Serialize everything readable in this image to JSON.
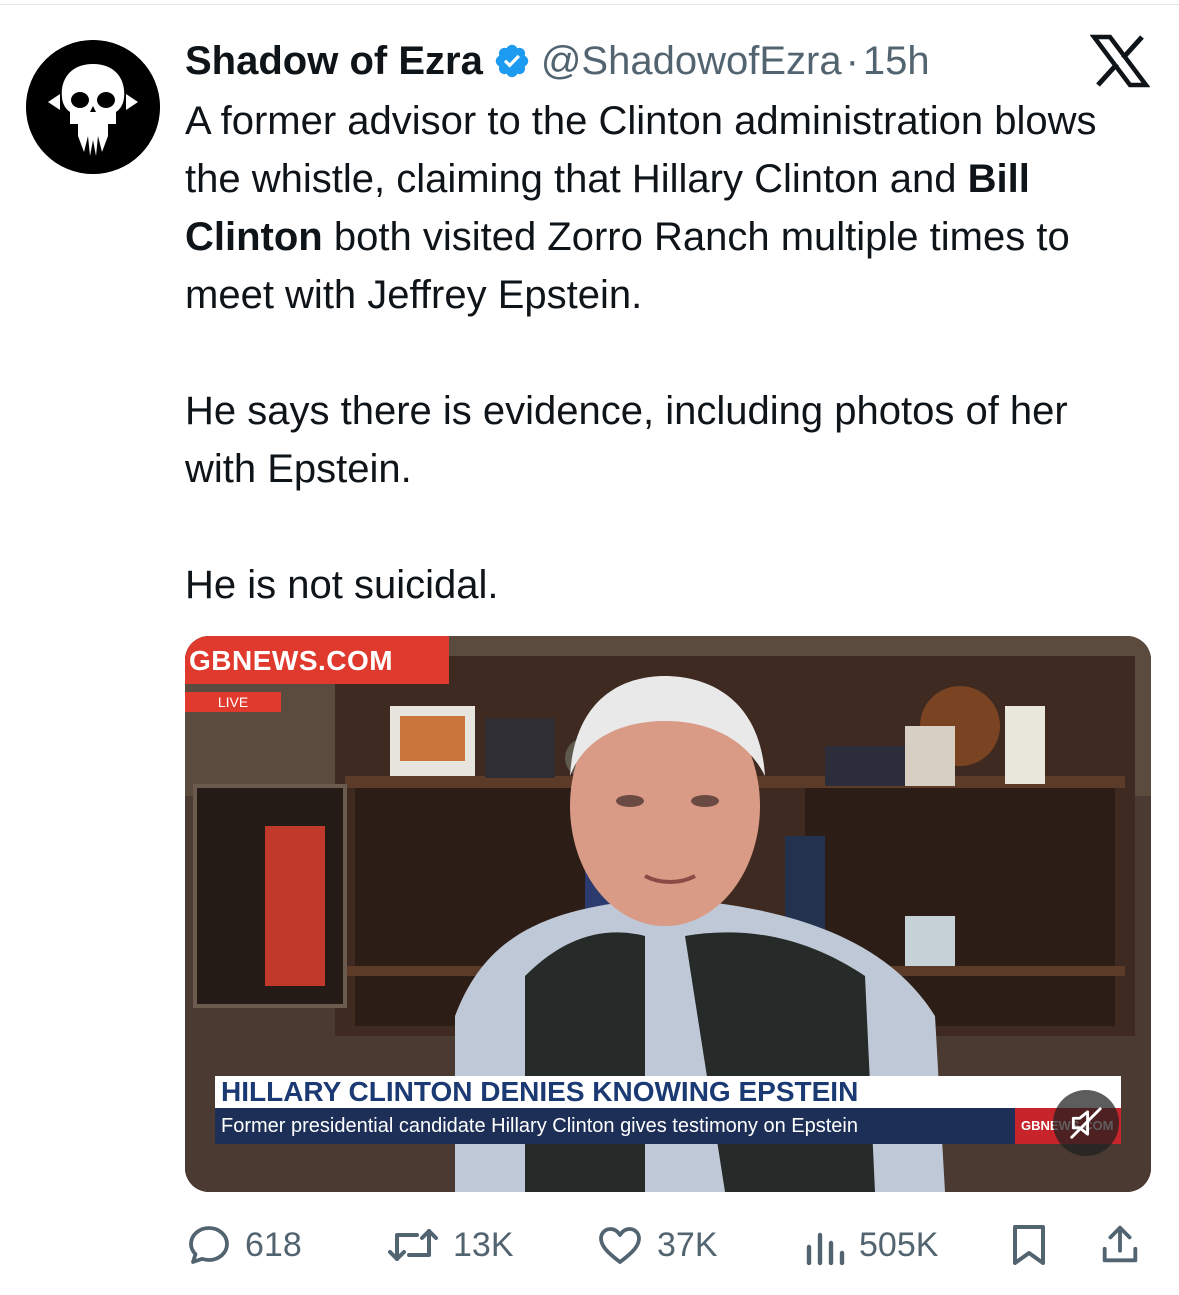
{
  "tweet": {
    "display_name": "Shadow of Ezra",
    "handle": "@ShadowofEzra",
    "separator": "·",
    "time": "15h",
    "verified": true,
    "paragraphs": [
      {
        "before": "A former advisor to the Clinton administration blows the whistle, claiming that Hillary Clinton and ",
        "bold": "Bill Clinton",
        "after": " both visited Zorro Ranch multiple times to meet with Jeffrey Epstein."
      },
      {
        "text": "He says there is evidence, including photos of her with Epstein."
      },
      {
        "text": "He is not suicidal."
      }
    ]
  },
  "media": {
    "brand": "GBNEWS.COM",
    "live": "LIVE",
    "headline": "HILLARY CLINTON DENIES KNOWING EPSTEIN",
    "subheadline": "Former presidential candidate Hillary Clinton gives testimony on Epstein",
    "corner_logo": "GBNEWS.COM",
    "muted": true
  },
  "actions": {
    "replies": "618",
    "reposts": "13K",
    "likes": "37K",
    "views": "505K"
  },
  "colors": {
    "text": "#0f1419",
    "muted": "#536471",
    "verified": "#1d9bf0",
    "gb_red": "#e03a2e",
    "gb_navy": "#1d2f57"
  },
  "icons": [
    "x-logo-icon",
    "verified-badge-icon",
    "reply-icon",
    "repost-icon",
    "like-icon",
    "views-icon",
    "bookmark-icon",
    "share-icon",
    "mute-icon"
  ]
}
